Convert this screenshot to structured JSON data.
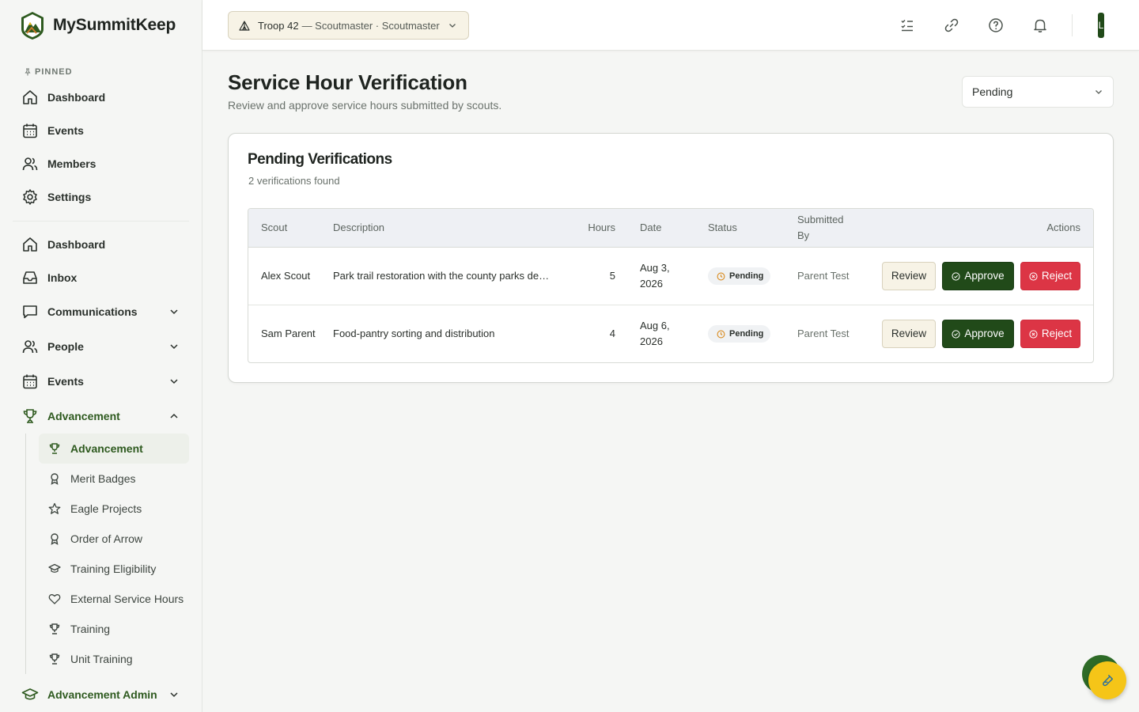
{
  "app": {
    "name": "MySummitKeep"
  },
  "colors": {
    "brand_green": "#214a19",
    "accent_green": "#2e5a1f",
    "reject_red": "#dc3545",
    "fab_yellow": "#f5c518"
  },
  "sidebar": {
    "pinned_label": "PINNED",
    "pinned": [
      {
        "label": "Dashboard",
        "icon": "home-icon"
      },
      {
        "label": "Events",
        "icon": "calendar-icon"
      },
      {
        "label": "Members",
        "icon": "users-icon"
      },
      {
        "label": "Settings",
        "icon": "gear-icon"
      }
    ],
    "items": [
      {
        "label": "Dashboard",
        "icon": "home-icon"
      },
      {
        "label": "Inbox",
        "icon": "inbox-icon"
      },
      {
        "label": "Communications",
        "icon": "message-icon",
        "expandable": true
      },
      {
        "label": "People",
        "icon": "users-icon",
        "expandable": true
      },
      {
        "label": "Events",
        "icon": "calendar-icon",
        "expandable": true
      },
      {
        "label": "Advancement",
        "icon": "trophy-icon",
        "expanded": true
      }
    ],
    "advancement_sub": [
      {
        "label": "Advancement",
        "icon": "trophy-icon",
        "active": true
      },
      {
        "label": "Merit Badges",
        "icon": "award-icon"
      },
      {
        "label": "Eagle Projects",
        "icon": "star-icon"
      },
      {
        "label": "Order of Arrow",
        "icon": "award-icon"
      },
      {
        "label": "Training Eligibility",
        "icon": "graduation-cap-icon"
      },
      {
        "label": "External Service Hours",
        "icon": "heart-icon"
      },
      {
        "label": "Training",
        "icon": "trophy-icon"
      },
      {
        "label": "Unit Training",
        "icon": "trophy-icon"
      }
    ],
    "admin": {
      "label": "Advancement Admin",
      "icon": "graduation-cap-icon"
    }
  },
  "topbar": {
    "unit": "Troop 42",
    "role": "— Scoutmaster · Scoutmaster",
    "avatar_initial": "L",
    "icons": [
      "checklist-icon",
      "link-icon",
      "help-icon",
      "bell-icon"
    ]
  },
  "page": {
    "title": "Service Hour Verification",
    "subtitle": "Review and approve service hours submitted by scouts.",
    "filter_value": "Pending"
  },
  "card": {
    "title": "Pending Verifications",
    "count_text": "2 verifications found",
    "columns": {
      "scout": "Scout",
      "description": "Description",
      "hours": "Hours",
      "date": "Date",
      "status": "Status",
      "submitted_by": "Submitted By",
      "actions": "Actions"
    },
    "rows": [
      {
        "scout": "Alex Scout",
        "description": "Park trail restoration with the county parks de…",
        "hours": "5",
        "date": "Aug 3, 2026",
        "status": "Pending",
        "submitted_by": "Parent Test"
      },
      {
        "scout": "Sam Parent",
        "description": "Food-pantry sorting and distribution",
        "hours": "4",
        "date": "Aug 6, 2026",
        "status": "Pending",
        "submitted_by": "Parent Test"
      }
    ],
    "actions": {
      "review": "Review",
      "approve": "Approve",
      "reject": "Reject"
    }
  }
}
